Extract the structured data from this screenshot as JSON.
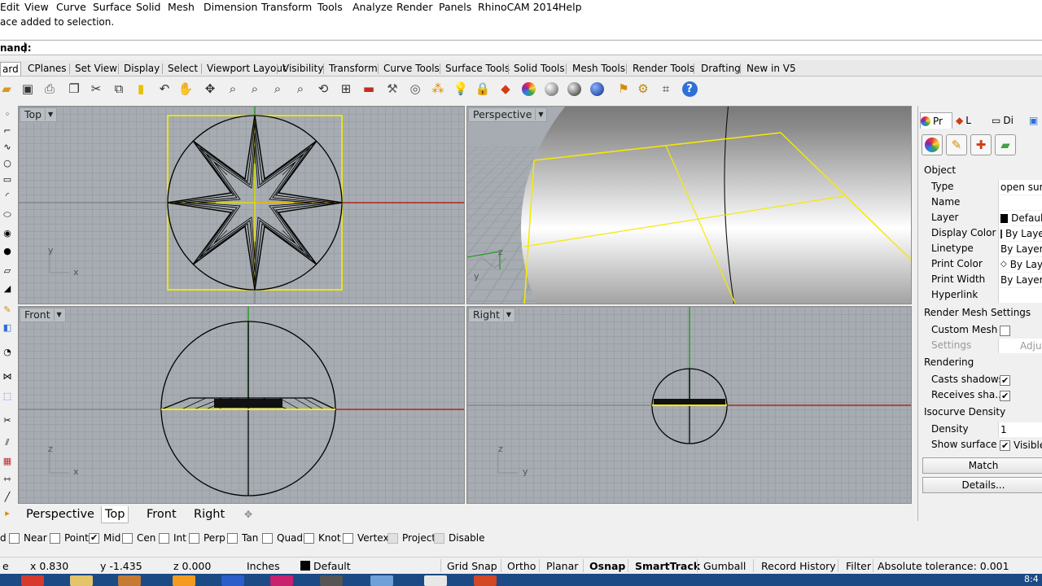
{
  "menu": [
    "Edit",
    "View",
    "Curve",
    "Surface",
    "Solid",
    "Mesh",
    "Dimension",
    "Transform",
    "Tools",
    "Analyze",
    "Render",
    "Panels",
    "RhinoCAM 2014",
    "Help"
  ],
  "command": {
    "history": "ace added to selection.",
    "prompt_label": "nand:"
  },
  "toolbar_tabs": [
    "ard",
    "CPlanes",
    "Set View",
    "Display",
    "Select",
    "Viewport Layout",
    "Visibility",
    "Transform",
    "Curve Tools",
    "Surface Tools",
    "Solid Tools",
    "Mesh Tools",
    "Render Tools",
    "Drafting",
    "New in V5"
  ],
  "toolbar_icons": [
    "open-icon",
    "save-icon",
    "print-icon",
    "import-icon",
    "cut-icon",
    "copy-icon",
    "paste-icon",
    "undo-icon",
    "pan-icon",
    "move-icon",
    "zoom-icon",
    "zoom-window-icon",
    "zoom-extents-icon",
    "zoom-selected-icon",
    "rotate-view-icon",
    "four-viewports-icon",
    "car-icon",
    "wrench-icon",
    "target-icon",
    "snap-icon",
    "light-icon",
    "lock-icon",
    "layer-icon",
    "color-wheel-icon",
    "shaded-sphere-icon",
    "rendered-sphere-icon",
    "glass-sphere-icon",
    "select-filter-icon",
    "options-gear-icon",
    "grid-icon",
    "help-icon"
  ],
  "viewports": {
    "top": "Top",
    "perspective": "Perspective",
    "front": "Front",
    "right": "Right"
  },
  "axes": {
    "top_x": "x",
    "top_y": "y",
    "persp_y": "y",
    "persp_z": "z",
    "front_x": "x",
    "front_z": "z",
    "right_y": "y",
    "right_z": "z"
  },
  "viewport_tabs": [
    "Perspective",
    "Top",
    "Front",
    "Right"
  ],
  "add_tab_symbol": "✥",
  "osnaps": [
    {
      "label": "d",
      "checked": false,
      "disabled": false
    },
    {
      "label": "Near",
      "checked": false,
      "disabled": false
    },
    {
      "label": "Point",
      "checked": false,
      "disabled": false
    },
    {
      "label": "Mid",
      "checked": true,
      "disabled": false
    },
    {
      "label": "Cen",
      "checked": false,
      "disabled": false
    },
    {
      "label": "Int",
      "checked": false,
      "disabled": false
    },
    {
      "label": "Perp",
      "checked": false,
      "disabled": false
    },
    {
      "label": "Tan",
      "checked": false,
      "disabled": false
    },
    {
      "label": "Quad",
      "checked": false,
      "disabled": false
    },
    {
      "label": "Knot",
      "checked": false,
      "disabled": false
    },
    {
      "label": "Vertex",
      "checked": false,
      "disabled": false
    },
    {
      "label": "Project",
      "checked": false,
      "disabled": true
    },
    {
      "label": "Disable",
      "checked": false,
      "disabled": true
    }
  ],
  "status": {
    "x": "x 0.830",
    "y": "y -1.435",
    "z": "z 0.000",
    "units": "Inches",
    "layer": "Default",
    "toggles": [
      {
        "label": "Grid Snap",
        "bold": false
      },
      {
        "label": "Ortho",
        "bold": false
      },
      {
        "label": "Planar",
        "bold": false
      },
      {
        "label": "Osnap",
        "bold": true
      },
      {
        "label": "SmartTrack",
        "bold": true
      },
      {
        "label": "Gumball",
        "bold": false
      },
      {
        "label": "Record History",
        "bold": false
      },
      {
        "label": "Filter",
        "bold": false
      }
    ],
    "tolerance": "Absolute tolerance: 0.001"
  },
  "props": {
    "tabs": [
      "Pr",
      "L",
      "Di"
    ],
    "section_object": "Object",
    "rows": [
      {
        "k": "Type",
        "v": "open surface"
      },
      {
        "k": "Name",
        "v": ""
      },
      {
        "k": "Layer",
        "v": "Default"
      },
      {
        "k": "Display Color",
        "v": "By Layer"
      },
      {
        "k": "Linetype",
        "v": "By Layer"
      },
      {
        "k": "Print Color",
        "v": "By Layer"
      },
      {
        "k": "Print Width",
        "v": "By Layer"
      },
      {
        "k": "Hyperlink",
        "v": ""
      }
    ],
    "section_mesh": "Render Mesh Settings",
    "custom_mesh": "Custom Mesh",
    "settings": "Settings",
    "adjust": "Adjust",
    "section_rendering": "Rendering",
    "casts_shadows": "Casts shadows",
    "receives_shadows": "Receives sha...",
    "section_iso": "Isocurve Density",
    "density": "Density",
    "density_val": "1",
    "show_surface": "Show surface ...",
    "visible": "Visible",
    "match": "Match",
    "details": "Details..."
  },
  "taskbar": {
    "clock": "8:4"
  },
  "colors": {
    "grid_bg": "#a6acb1",
    "selection": "#f5ea00",
    "axis_x": "#b52a1e",
    "axis_y": "#2a9a2a",
    "taskbar": "#1b4a85"
  }
}
